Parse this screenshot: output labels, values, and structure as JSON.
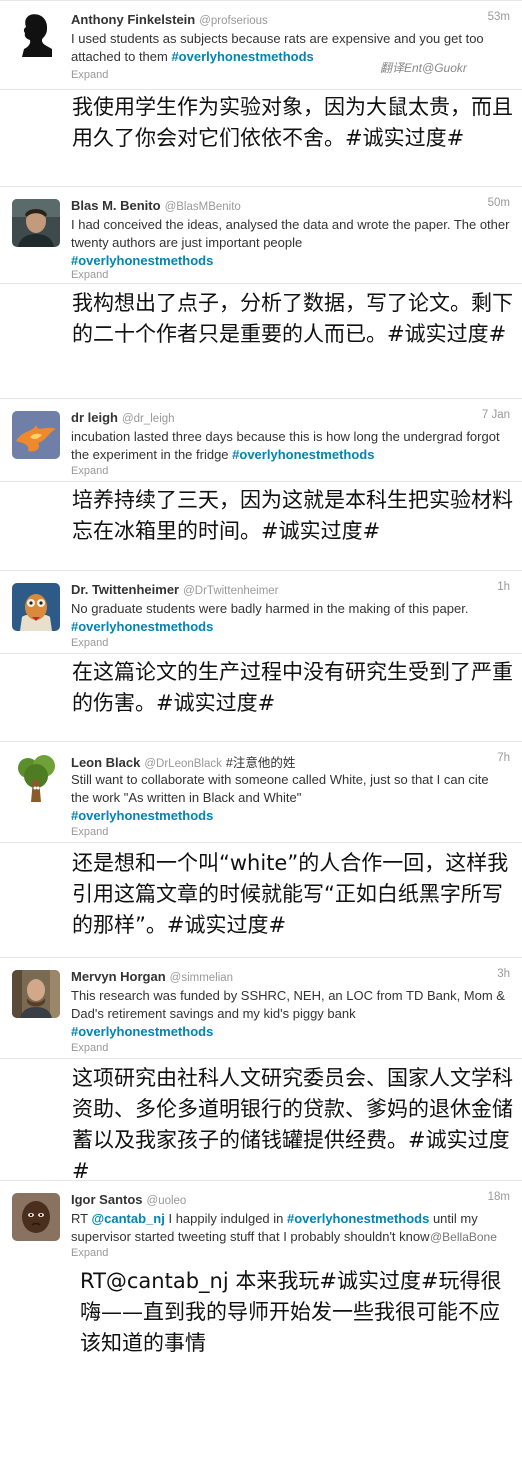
{
  "colors": {
    "link": "#0084b4",
    "name": "#333333",
    "meta": "#999999"
  },
  "expand_label": "Expand",
  "watermarks": {
    "top": "翻译Ent@Guokr",
    "bottom": "@BellaBone"
  },
  "tweets": [
    {
      "name": "Anthony Finkelstein",
      "handle": "@profserious",
      "time": "53m",
      "text_before": "I used students as subjects because rats are expensive and you get too attached to them ",
      "hashtag": "#overlyhonestmethods",
      "avatar": "silhouette-icon",
      "translation": "我使用学生作为实验对象，因为大鼠太贵，而且用久了你会对它们依依不舍。#诚实过度#"
    },
    {
      "name": "Blas M. Benito",
      "handle": "@BlasMBenito",
      "time": "50m",
      "text_before": "I had conceived the ideas, analysed the data and wrote the paper. The other twenty authors are just important people",
      "hashtag": "#overlyhonestmethods",
      "avatar": "person-photo-icon",
      "translation": "我构想出了点子，分析了数据，写了论文。剩下的二十个作者只是重要的人而已。#诚实过度#"
    },
    {
      "name": "dr leigh",
      "handle": "@dr_leigh",
      "time": "7 Jan",
      "text_before": "incubation lasted three days because this is how long the undergrad forgot the experiment in the fridge ",
      "hashtag": "#overlyhonestmethods",
      "avatar": "phoenix-icon",
      "translation": "培养持续了三天，因为这就是本科生把实验材料忘在冰箱里的时间。#诚实过度#"
    },
    {
      "name": "Dr. Twittenheimer",
      "handle": "@DrTwittenheimer",
      "time": "1h",
      "text_before": "No graduate students were badly harmed in the making of this paper. ",
      "hashtag": "#overlyhonestmethods",
      "avatar": "muppet-icon",
      "translation": "在这篇论文的生产过程中没有研究生受到了严重的伤害。#诚实过度#"
    },
    {
      "name": "Leon Black",
      "handle": "@DrLeonBlack",
      "time": "7h",
      "note": "#注意他的姓",
      "text_before": "Still want to collaborate with someone called White, just so that I can cite the work \"As written in Black and White\"",
      "hashtag": "#overlyhonestmethods",
      "avatar": "tree-icon",
      "translation": "还是想和一个叫“white”的人合作一回，这样我引用这篇文章的时候就能写“正如白纸黑字所写的那样”。#诚实过度#"
    },
    {
      "name": "Mervyn Horgan",
      "handle": "@simmelian",
      "time": "3h",
      "text_before": "This research was funded by SSHRC, NEH, an LOC from TD Bank, Mom & Dad's retirement savings and my kid's piggy bank",
      "hashtag": "#overlyhonestmethods",
      "avatar": "person-photo-icon",
      "translation": "这项研究由社科人文研究委员会、国家人文学科资助、多伦多道明银行的贷款、爹妈的退休金储蓄以及我家孩子的储钱罐提供经费。#诚实过度#"
    },
    {
      "name": "Igor Santos",
      "handle": "@uoleo",
      "time": "18m",
      "text_before": "RT ",
      "mention": "@cantab_nj",
      "text_mid": " I happily indulged in ",
      "hashtag": "#overlyhonestmethods",
      "text_after": " until my supervisor started tweeting stuff that I probably shouldn't know",
      "avatar": "child-photo-icon",
      "translation": "RT@cantab_nj 本来我玩#诚实过度#玩得很嗨——直到我的导师开始发一些我很可能不应该知道的事情"
    }
  ]
}
